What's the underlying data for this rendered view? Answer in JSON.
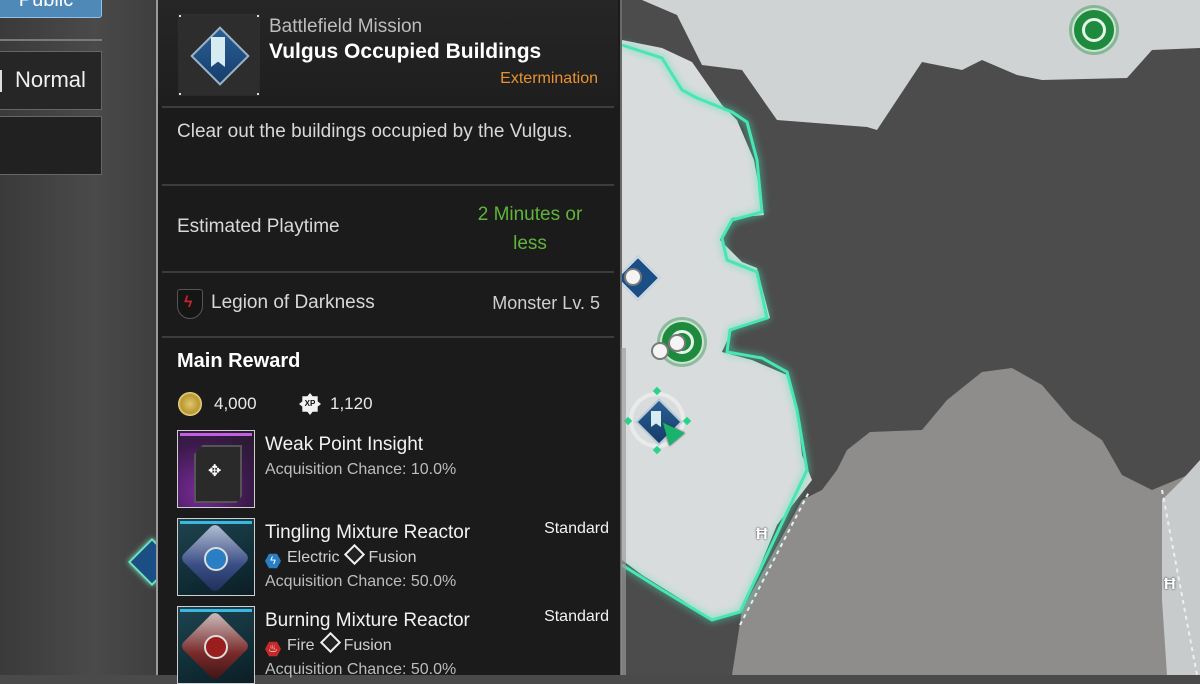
{
  "settings": {
    "visibility_label": "Public",
    "difficulty_label": "Normal"
  },
  "mission": {
    "category": "Battlefield Mission",
    "title": "Vulgus Occupied Buildings",
    "type": "Extermination",
    "description": "Clear out the buildings occupied by the Vulgus.",
    "playtime_label": "Estimated Playtime",
    "playtime_value": "2 Minutes or less",
    "faction_icon": "legion-emblem-icon",
    "faction_name": "Legion of Darkness",
    "monster_level": "Monster Lv. 5"
  },
  "rewards": {
    "heading": "Main Reward",
    "gold": {
      "icon": "gold-coin-icon",
      "value": "4,000"
    },
    "xp": {
      "icon": "xp-badge-icon",
      "label": "XP",
      "value": "1,120"
    },
    "items": [
      {
        "name": "Weak Point Insight",
        "chance": "Acquisition Chance: 10.0%",
        "tier": "",
        "rarity_color": "#c060e0",
        "icon": "module-chip-icon"
      },
      {
        "name": "Tingling Mixture Reactor",
        "element": "Electric",
        "element_color": "#2a7fc4",
        "element_glyph": "⚡",
        "skill_type": "Fusion",
        "chance": "Acquisition Chance: 50.0%",
        "tier": "Standard",
        "rarity_color": "#3ab8e0",
        "icon": "electric-reactor-icon"
      },
      {
        "name": "Burning Mixture Reactor",
        "element": "Fire",
        "element_color": "#c42a2a",
        "element_glyph": "🔥",
        "skill_type": "Fusion",
        "chance": "Acquisition Chance: 50.0%",
        "tier": "Standard",
        "rarity_color": "#3ab8e0",
        "icon": "fire-reactor-icon"
      }
    ]
  },
  "map": {
    "boundary_color": "#47e6b4",
    "poi_color_green": "#1e8a3e",
    "poi_color_blue": "#1c4e86"
  }
}
